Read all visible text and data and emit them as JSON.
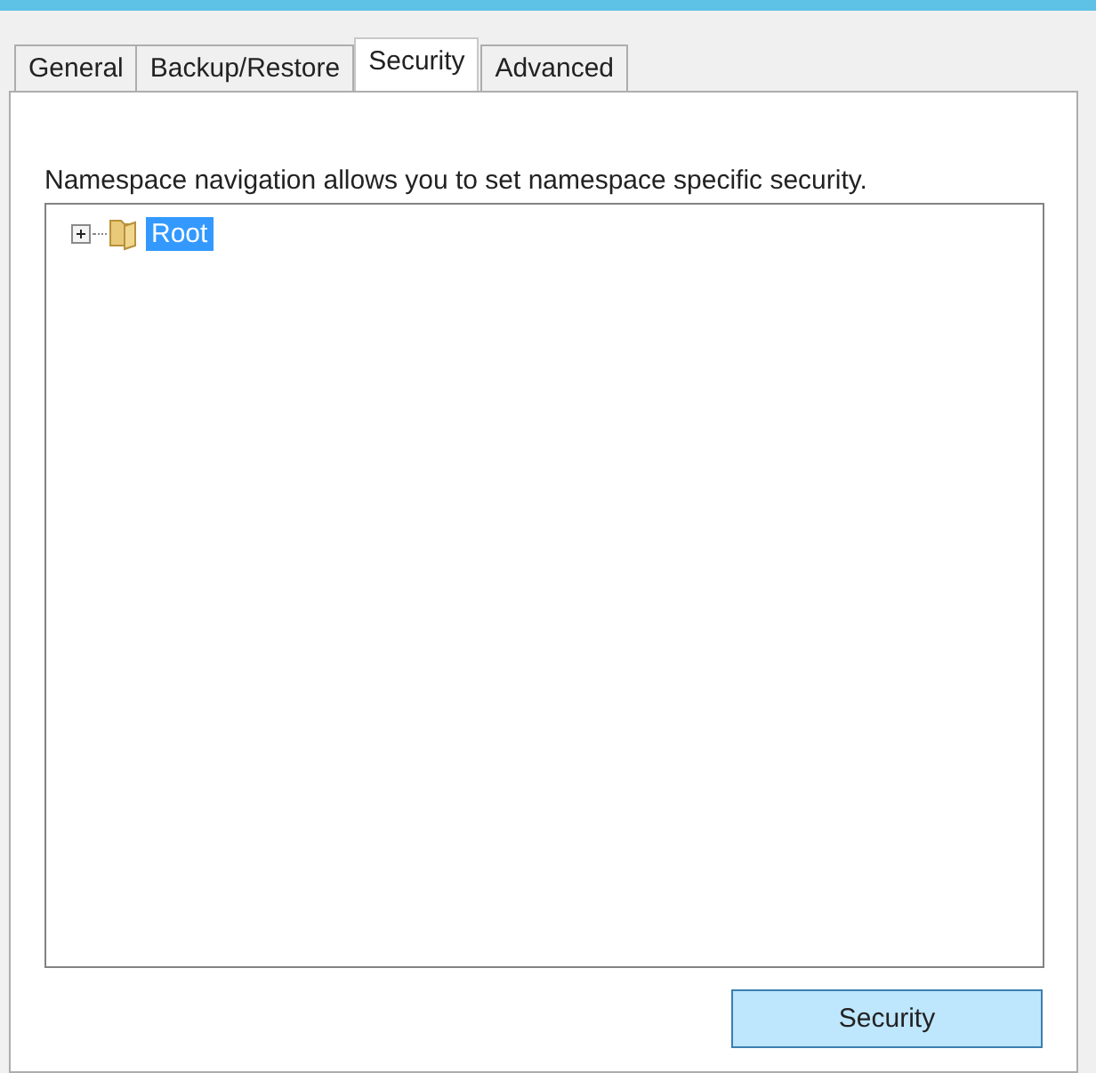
{
  "tabs": [
    {
      "label": "General",
      "selected": false
    },
    {
      "label": "Backup/Restore",
      "selected": false
    },
    {
      "label": "Security",
      "selected": true
    },
    {
      "label": "Advanced",
      "selected": false
    }
  ],
  "description": "Namespace navigation allows you to set namespace specific security.",
  "tree": [
    {
      "label": "Root",
      "expanded": false,
      "selected": true
    }
  ],
  "button": "Security"
}
